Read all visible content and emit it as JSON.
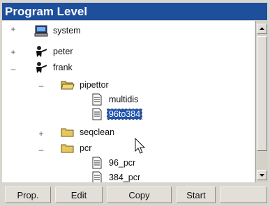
{
  "window": {
    "title": "Program Level"
  },
  "tree": [
    {
      "label": "system",
      "icon": "computer-icon",
      "expander": "+"
    },
    {
      "label": "peter",
      "icon": "user-icon",
      "expander": "+"
    },
    {
      "label": "frank",
      "icon": "user-icon",
      "expander": "–"
    },
    {
      "label": "pipettor",
      "icon": "open-folder-icon",
      "expander": "–"
    },
    {
      "label": "multidis",
      "icon": "file-icon",
      "expander": ""
    },
    {
      "label": "96to384",
      "icon": "file-icon",
      "expander": "",
      "selected": true
    },
    {
      "label": "seqclean",
      "icon": "folder-icon",
      "expander": "+"
    },
    {
      "label": "pcr",
      "icon": "folder-icon",
      "expander": "–"
    },
    {
      "label": "96_pcr",
      "icon": "file-icon",
      "expander": ""
    },
    {
      "label": "384_pcr",
      "icon": "file-icon",
      "expander": ""
    }
  ],
  "buttons": {
    "prop": "Prop.",
    "edit": "Edit",
    "copy": "Copy",
    "start": "Start",
    "blank": ""
  },
  "colors": {
    "titlebar": "#1e4f9c",
    "selection": "#1e56b0",
    "folder": "#e8c75a"
  }
}
